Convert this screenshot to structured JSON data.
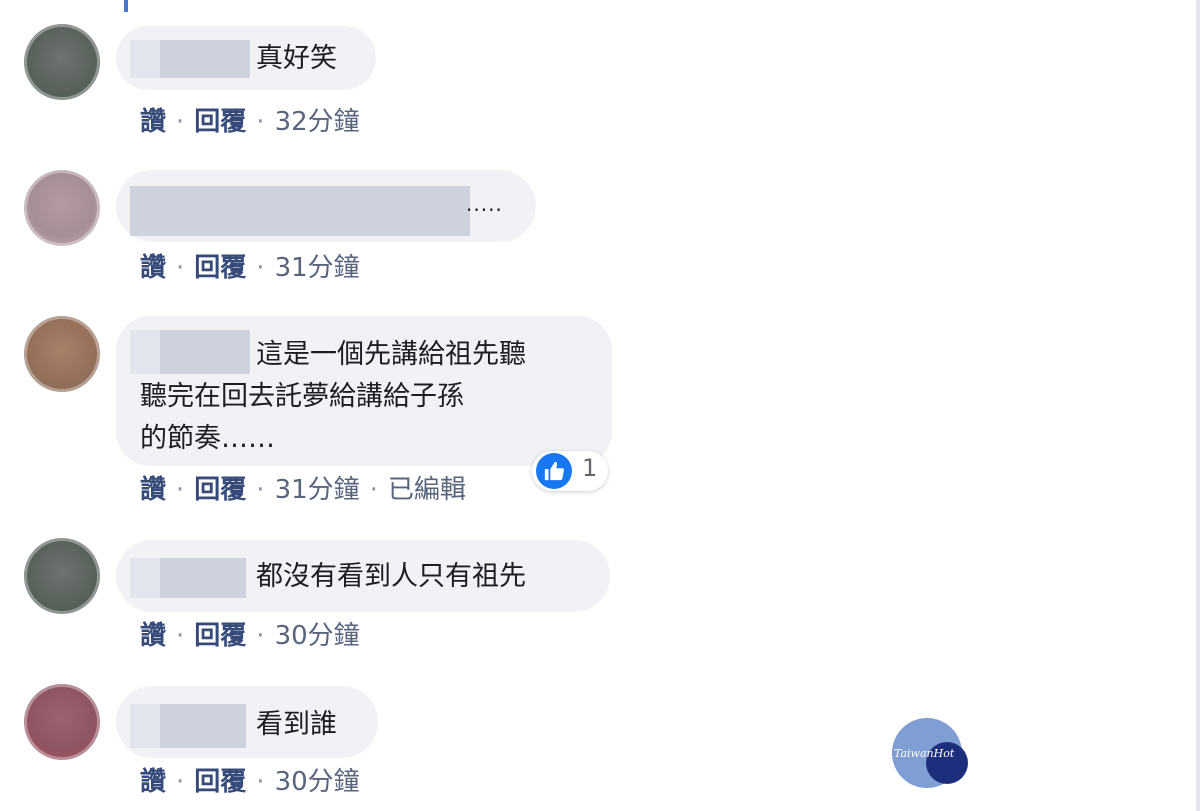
{
  "comments": [
    {
      "text": "真好笑",
      "actions": {
        "like": "讚",
        "reply": "回覆",
        "time": "32分鐘"
      }
    },
    {
      "text": ".....",
      "actions": {
        "like": "讚",
        "reply": "回覆",
        "time": "31分鐘"
      }
    },
    {
      "lines": [
        "這是一個先講給祖先聽",
        "聽完在回去託夢給講給子孫",
        "的節奏……"
      ],
      "reaction": {
        "icon": "thumbs-up-icon",
        "count": "1"
      },
      "actions": {
        "like": "讚",
        "reply": "回覆",
        "time": "31分鐘",
        "edited": "已編輯"
      }
    },
    {
      "text": "都沒有看到人只有祖先",
      "actions": {
        "like": "讚",
        "reply": "回覆",
        "time": "30分鐘"
      }
    },
    {
      "text": "看到誰",
      "actions": {
        "like": "讚",
        "reply": "回覆",
        "time": "30分鐘"
      }
    }
  ],
  "watermark": {
    "text": "TaiwanHot"
  },
  "colors": {
    "bubble": "#f0f2f5",
    "redaction": "#cdd2dc",
    "like_blue": "#1877f2",
    "action_link": "#364b7a"
  }
}
